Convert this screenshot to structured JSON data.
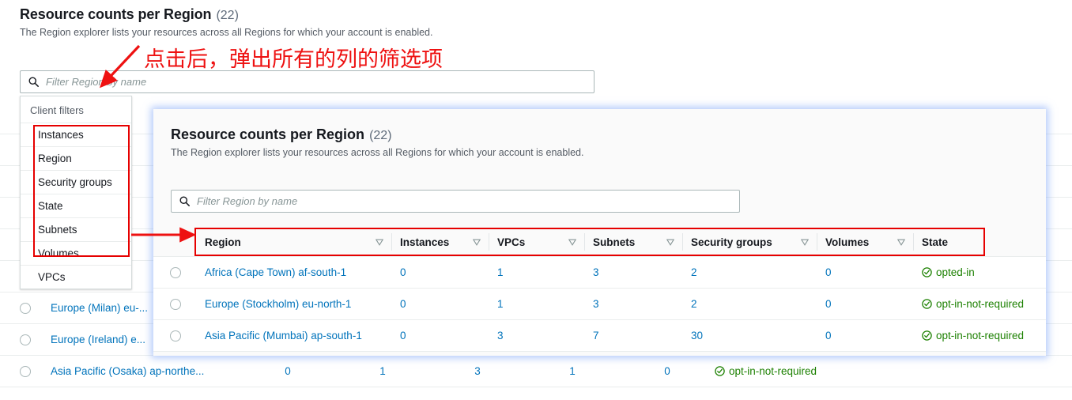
{
  "background": {
    "title": "Resource counts per Region",
    "count": "(22)",
    "description": "The Region explorer lists your resources across all Regions for which your account is enabled.",
    "search_placeholder": "Filter Region by name",
    "rows": [
      {
        "region": "Europe (Milan) eu-...",
        "instances": "",
        "vpcs": "",
        "subnets": "",
        "security_groups": "",
        "volumes": "",
        "state": ""
      },
      {
        "region": "Europe (Ireland) e...",
        "instances": "",
        "vpcs": "",
        "subnets": "",
        "security_groups": "",
        "volumes": "",
        "state": ""
      },
      {
        "region": "Asia Pacific (Osaka) ap-northe...",
        "instances": "0",
        "vpcs": "1",
        "subnets": "3",
        "security_groups": "1",
        "volumes": "0",
        "state": "opt-in-not-required"
      }
    ]
  },
  "client_filters": {
    "heading": "Client filters",
    "items": [
      {
        "label": "Instances"
      },
      {
        "label": "Region"
      },
      {
        "label": "Security groups"
      },
      {
        "label": "State"
      },
      {
        "label": "Subnets"
      },
      {
        "label": "Volumes"
      },
      {
        "label": "VPCs"
      }
    ]
  },
  "overlay": {
    "title": "Resource counts per Region",
    "count": "(22)",
    "description": "The Region explorer lists your resources across all Regions for which your account is enabled.",
    "search_placeholder": "Filter Region by name",
    "columns": [
      {
        "label": "Region",
        "sortable": true
      },
      {
        "label": "Instances",
        "sortable": true
      },
      {
        "label": "VPCs",
        "sortable": true
      },
      {
        "label": "Subnets",
        "sortable": true
      },
      {
        "label": "Security groups",
        "sortable": true
      },
      {
        "label": "Volumes",
        "sortable": true
      },
      {
        "label": "State",
        "sortable": false
      }
    ],
    "rows": [
      {
        "region": "Africa (Cape Town) af-south-1",
        "instances": "0",
        "vpcs": "1",
        "subnets": "3",
        "security_groups": "2",
        "volumes": "0",
        "state": "opted-in"
      },
      {
        "region": "Europe (Stockholm) eu-north-1",
        "instances": "0",
        "vpcs": "1",
        "subnets": "3",
        "security_groups": "2",
        "volumes": "0",
        "state": "opt-in-not-required"
      },
      {
        "region": "Asia Pacific (Mumbai) ap-south-1",
        "instances": "0",
        "vpcs": "3",
        "subnets": "7",
        "security_groups": "30",
        "volumes": "0",
        "state": "opt-in-not-required"
      }
    ]
  },
  "annotation": {
    "text": "点击后，弹出所有的列的筛选项",
    "color": "#ee1111"
  },
  "colors": {
    "link": "#0073bb",
    "state_green": "#1d8102",
    "annotation_red": "#e60000",
    "overlay_glow": "#78a0f5"
  },
  "icons": {
    "search": "search-icon",
    "sort": "sort-caret-icon",
    "status": "check-circle-icon",
    "radio": "radio-button-icon"
  }
}
